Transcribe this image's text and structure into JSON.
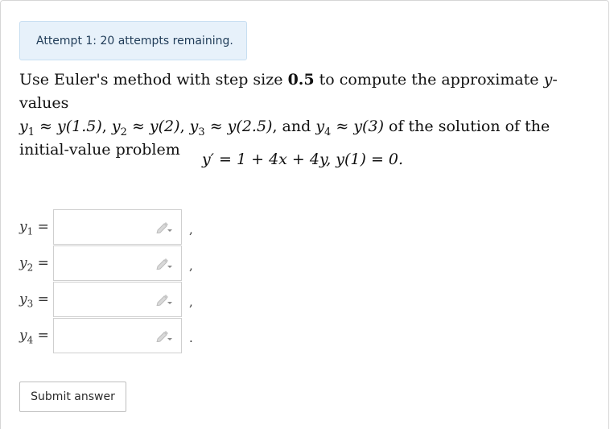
{
  "attempt_banner": "Attempt 1: 20 attempts remaining.",
  "question": {
    "line1_prefix": "Use Euler's method with step size ",
    "step_size": "0.5",
    "line1_suffix": " to compute the approximate ",
    "y_var": "y",
    "line1_end": "-values",
    "approx_list": [
      {
        "sym": "y",
        "sub": "1",
        "rel": " ≈ ",
        "val": "y(1.5)",
        "sep": ", "
      },
      {
        "sym": "y",
        "sub": "2",
        "rel": " ≈ ",
        "val": "y(2)",
        "sep": ", "
      },
      {
        "sym": "y",
        "sub": "3",
        "rel": " ≈ ",
        "val": "y(2.5)",
        "sep": ", and "
      },
      {
        "sym": "y",
        "sub": "4",
        "rel": " ≈ ",
        "val": "y(3)",
        "sep": ""
      }
    ],
    "line2_suffix": " of the solution of the initial-value problem"
  },
  "equation": "y′ = 1 + 4x + 4y,   y(1) = 0.",
  "answers": [
    {
      "sym": "y",
      "sub": "1",
      "eq": " =",
      "value": "",
      "punct": ","
    },
    {
      "sym": "y",
      "sub": "2",
      "eq": " =",
      "value": "",
      "punct": ","
    },
    {
      "sym": "y",
      "sub": "3",
      "eq": " =",
      "value": "",
      "punct": ","
    },
    {
      "sym": "y",
      "sub": "4",
      "eq": " =",
      "value": "",
      "punct": "."
    }
  ],
  "submit_label": "Submit answer",
  "icons": {
    "answer_field": "pencil-icon"
  },
  "colors": {
    "banner_bg": "#e7f1fa",
    "banner_border": "#c7def1",
    "border": "#cfcfcf"
  }
}
